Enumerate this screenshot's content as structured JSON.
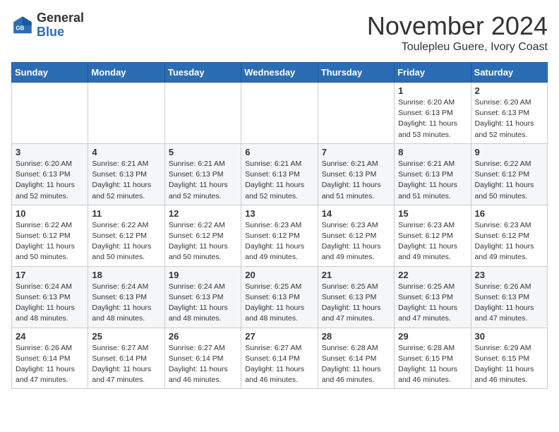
{
  "header": {
    "logo_general": "General",
    "logo_blue": "Blue",
    "month_title": "November 2024",
    "location": "Toulepleu Guere, Ivory Coast"
  },
  "days_of_week": [
    "Sunday",
    "Monday",
    "Tuesday",
    "Wednesday",
    "Thursday",
    "Friday",
    "Saturday"
  ],
  "weeks": [
    [
      {
        "day": "",
        "info": ""
      },
      {
        "day": "",
        "info": ""
      },
      {
        "day": "",
        "info": ""
      },
      {
        "day": "",
        "info": ""
      },
      {
        "day": "",
        "info": ""
      },
      {
        "day": "1",
        "info": "Sunrise: 6:20 AM\nSunset: 6:13 PM\nDaylight: 11 hours and 53 minutes."
      },
      {
        "day": "2",
        "info": "Sunrise: 6:20 AM\nSunset: 6:13 PM\nDaylight: 11 hours and 52 minutes."
      }
    ],
    [
      {
        "day": "3",
        "info": "Sunrise: 6:20 AM\nSunset: 6:13 PM\nDaylight: 11 hours and 52 minutes."
      },
      {
        "day": "4",
        "info": "Sunrise: 6:21 AM\nSunset: 6:13 PM\nDaylight: 11 hours and 52 minutes."
      },
      {
        "day": "5",
        "info": "Sunrise: 6:21 AM\nSunset: 6:13 PM\nDaylight: 11 hours and 52 minutes."
      },
      {
        "day": "6",
        "info": "Sunrise: 6:21 AM\nSunset: 6:13 PM\nDaylight: 11 hours and 52 minutes."
      },
      {
        "day": "7",
        "info": "Sunrise: 6:21 AM\nSunset: 6:13 PM\nDaylight: 11 hours and 51 minutes."
      },
      {
        "day": "8",
        "info": "Sunrise: 6:21 AM\nSunset: 6:13 PM\nDaylight: 11 hours and 51 minutes."
      },
      {
        "day": "9",
        "info": "Sunrise: 6:22 AM\nSunset: 6:12 PM\nDaylight: 11 hours and 50 minutes."
      }
    ],
    [
      {
        "day": "10",
        "info": "Sunrise: 6:22 AM\nSunset: 6:12 PM\nDaylight: 11 hours and 50 minutes."
      },
      {
        "day": "11",
        "info": "Sunrise: 6:22 AM\nSunset: 6:12 PM\nDaylight: 11 hours and 50 minutes."
      },
      {
        "day": "12",
        "info": "Sunrise: 6:22 AM\nSunset: 6:12 PM\nDaylight: 11 hours and 50 minutes."
      },
      {
        "day": "13",
        "info": "Sunrise: 6:23 AM\nSunset: 6:12 PM\nDaylight: 11 hours and 49 minutes."
      },
      {
        "day": "14",
        "info": "Sunrise: 6:23 AM\nSunset: 6:12 PM\nDaylight: 11 hours and 49 minutes."
      },
      {
        "day": "15",
        "info": "Sunrise: 6:23 AM\nSunset: 6:12 PM\nDaylight: 11 hours and 49 minutes."
      },
      {
        "day": "16",
        "info": "Sunrise: 6:23 AM\nSunset: 6:12 PM\nDaylight: 11 hours and 49 minutes."
      }
    ],
    [
      {
        "day": "17",
        "info": "Sunrise: 6:24 AM\nSunset: 6:13 PM\nDaylight: 11 hours and 48 minutes."
      },
      {
        "day": "18",
        "info": "Sunrise: 6:24 AM\nSunset: 6:13 PM\nDaylight: 11 hours and 48 minutes."
      },
      {
        "day": "19",
        "info": "Sunrise: 6:24 AM\nSunset: 6:13 PM\nDaylight: 11 hours and 48 minutes."
      },
      {
        "day": "20",
        "info": "Sunrise: 6:25 AM\nSunset: 6:13 PM\nDaylight: 11 hours and 48 minutes."
      },
      {
        "day": "21",
        "info": "Sunrise: 6:25 AM\nSunset: 6:13 PM\nDaylight: 11 hours and 47 minutes."
      },
      {
        "day": "22",
        "info": "Sunrise: 6:25 AM\nSunset: 6:13 PM\nDaylight: 11 hours and 47 minutes."
      },
      {
        "day": "23",
        "info": "Sunrise: 6:26 AM\nSunset: 6:13 PM\nDaylight: 11 hours and 47 minutes."
      }
    ],
    [
      {
        "day": "24",
        "info": "Sunrise: 6:26 AM\nSunset: 6:14 PM\nDaylight: 11 hours and 47 minutes."
      },
      {
        "day": "25",
        "info": "Sunrise: 6:27 AM\nSunset: 6:14 PM\nDaylight: 11 hours and 47 minutes."
      },
      {
        "day": "26",
        "info": "Sunrise: 6:27 AM\nSunset: 6:14 PM\nDaylight: 11 hours and 46 minutes."
      },
      {
        "day": "27",
        "info": "Sunrise: 6:27 AM\nSunset: 6:14 PM\nDaylight: 11 hours and 46 minutes."
      },
      {
        "day": "28",
        "info": "Sunrise: 6:28 AM\nSunset: 6:14 PM\nDaylight: 11 hours and 46 minutes."
      },
      {
        "day": "29",
        "info": "Sunrise: 6:28 AM\nSunset: 6:15 PM\nDaylight: 11 hours and 46 minutes."
      },
      {
        "day": "30",
        "info": "Sunrise: 6:29 AM\nSunset: 6:15 PM\nDaylight: 11 hours and 46 minutes."
      }
    ]
  ]
}
